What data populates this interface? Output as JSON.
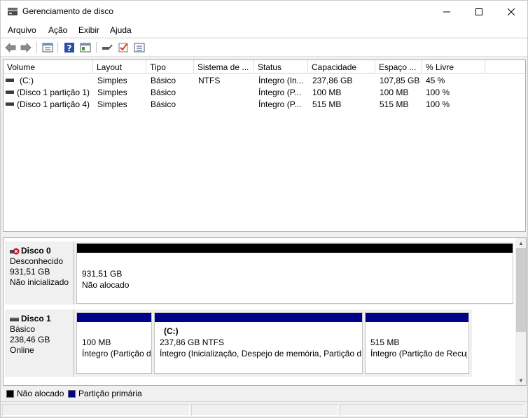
{
  "window": {
    "title": "Gerenciamento de disco"
  },
  "menu": [
    "Arquivo",
    "Ação",
    "Exibir",
    "Ajuda"
  ],
  "toolbar": [
    "back-icon",
    "forward-icon",
    "properties-icon",
    "help-icon",
    "view-icon",
    "connect-icon",
    "check-icon",
    "list-icon"
  ],
  "volumes": {
    "columns": [
      "Volume",
      "Layout",
      "Tipo",
      "Sistema de ...",
      "Status",
      "Capacidade",
      "Espaço ...",
      "% Livre"
    ],
    "rows": [
      {
        "volume": "(C:)",
        "layout": "Simples",
        "tipo": "Básico",
        "sistema": "NTFS",
        "status": "Íntegro (In...",
        "capacidade": "237,86 GB",
        "espaco": "107,85 GB",
        "livre": "45 %"
      },
      {
        "volume": "(Disco 1 partição 1)",
        "layout": "Simples",
        "tipo": "Básico",
        "sistema": "",
        "status": "Íntegro (P...",
        "capacidade": "100 MB",
        "espaco": "100 MB",
        "livre": "100 %"
      },
      {
        "volume": "(Disco 1 partição 4)",
        "layout": "Simples",
        "tipo": "Básico",
        "sistema": "",
        "status": "Íntegro (P...",
        "capacidade": "515 MB",
        "espaco": "515 MB",
        "livre": "100 %"
      }
    ]
  },
  "disks": [
    {
      "name": "Disco 0",
      "type": "Desconhecido",
      "size": "931,51 GB",
      "state": "Não inicializado",
      "partitions": [
        {
          "line1": "931,51 GB",
          "line2": "Não alocado"
        }
      ]
    },
    {
      "name": "Disco 1",
      "type": "Básico",
      "size": "238,46 GB",
      "state": "Online",
      "partitions": [
        {
          "label": "",
          "line1": "100 MB",
          "line2": "Íntegro (Partição de Sistema EFI)"
        },
        {
          "label": "(C:)",
          "line1": "237,86 GB NTFS",
          "line2": "Íntegro (Inicialização, Despejo de memória, Partição de Dados Básicos)"
        },
        {
          "label": "",
          "line1": "515 MB",
          "line2": "Íntegro (Partição de Recuperação)"
        }
      ]
    }
  ],
  "legend": [
    {
      "label": "Não alocado",
      "color": "#000000"
    },
    {
      "label": "Partição primária",
      "color": "#00008b"
    }
  ],
  "colors": {
    "unallocated": "#000000",
    "primary": "#00008b",
    "error_icon": "#c0001a"
  }
}
